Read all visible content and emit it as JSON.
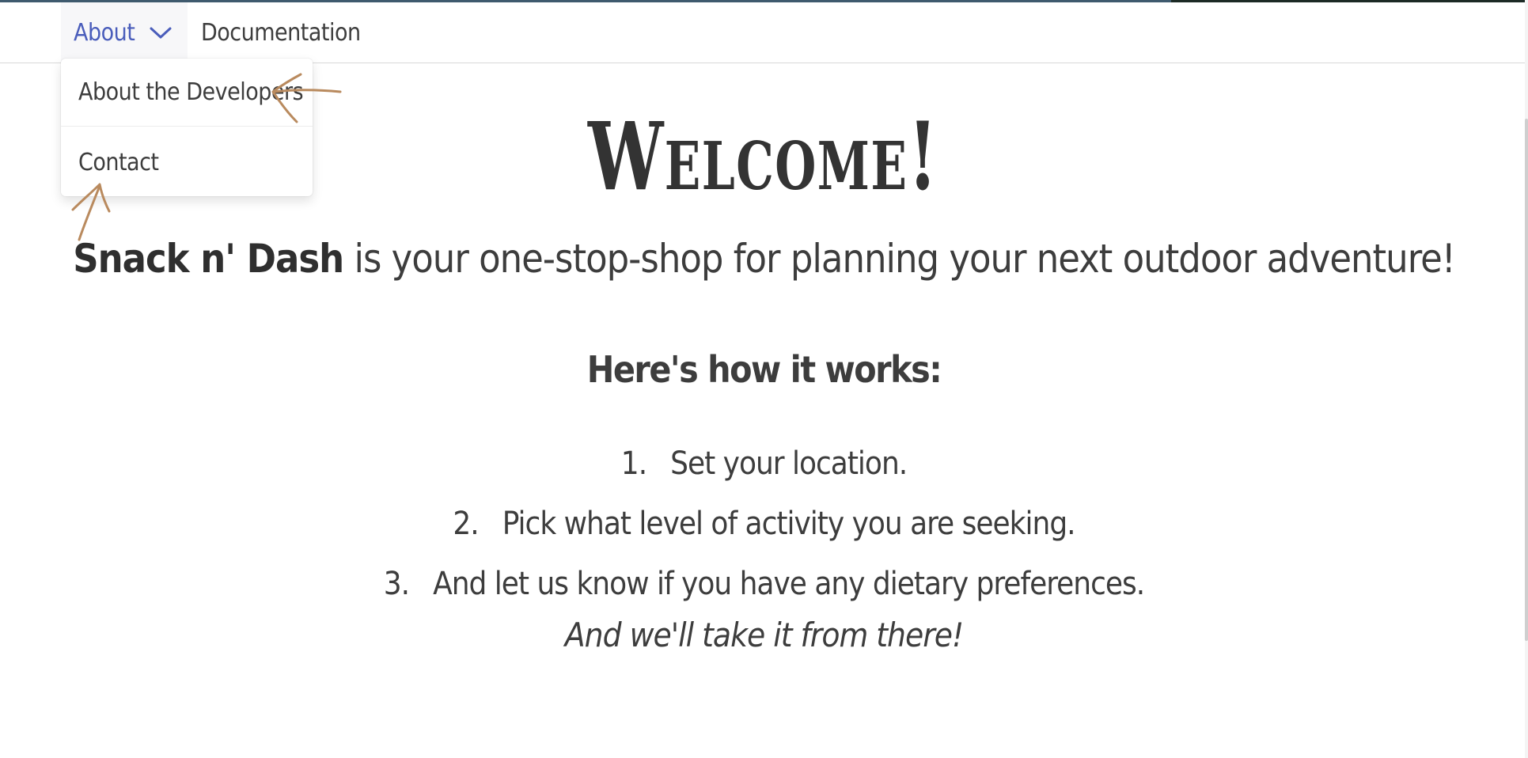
{
  "nav": {
    "about_label": "About",
    "documentation_label": "Documentation"
  },
  "dropdown": {
    "items": [
      {
        "label": "About the Developers"
      },
      {
        "label": "Contact"
      }
    ]
  },
  "hero": {
    "title": "Welcome!",
    "brand": "Snack n' Dash",
    "tagline_rest": " is your one-stop-shop for planning your next outdoor adventure!"
  },
  "how": {
    "heading": "Here's how it works:",
    "steps": [
      {
        "num": "1.",
        "text": "Set your location."
      },
      {
        "num": "2.",
        "text": "Pick what level of activity you are seeking."
      },
      {
        "num": "3.",
        "text": "And let us know if you have any dietary preferences."
      }
    ],
    "closing": "And we'll take it from there!"
  },
  "colors": {
    "accent": "#4a5dbb",
    "text": "#3d3d3d",
    "annotation": "#b98a5e"
  },
  "icons": {
    "about_toggle": "chevron-down-icon"
  }
}
